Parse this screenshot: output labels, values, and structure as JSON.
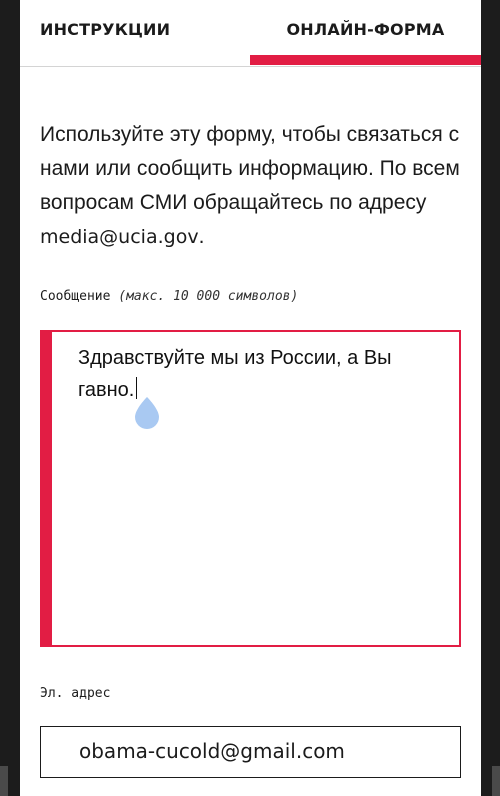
{
  "tabs": [
    {
      "label": "ИНСТРУКЦИИ",
      "active": false
    },
    {
      "label": "ОНЛАЙН-ФОРМА",
      "active": true
    }
  ],
  "intro": {
    "text": "Используйте эту форму, чтобы связаться с нами или сообщить информацию. По всем вопросам СМИ обращайтесь по адресу ",
    "email_link": "media@ucia.gov",
    "suffix": "."
  },
  "message_field": {
    "label": "Сообщение",
    "hint": "(макс. 10 000 символов)",
    "value": "Здравствуйте мы из России, а Вы гавно."
  },
  "email_field": {
    "label": "Эл. адрес",
    "value": "obama-cucold@gmail.com"
  },
  "colors": {
    "accent": "#e21d44",
    "text": "#1b1b1b",
    "background": "#ffffff",
    "cursor_handle": "#a9c9f2"
  }
}
